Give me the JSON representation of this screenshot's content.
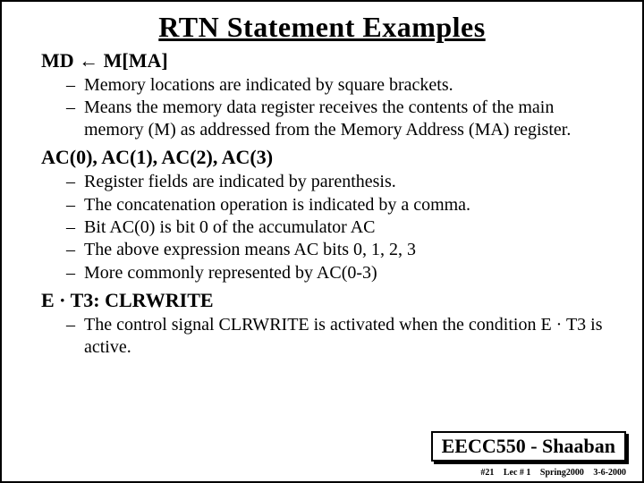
{
  "title": "RTN Statement Examples",
  "sections": [
    {
      "heading": "MD ←  M[MA]",
      "bullets": [
        "Memory locations are indicated by square brackets.",
        "Means the memory data register receives the contents of the main memory (M) as addressed from the Memory Address (MA) register."
      ]
    },
    {
      "heading": "AC(0), AC(1), AC(2), AC(3)",
      "bullets": [
        "Register fields are indicated by parenthesis.",
        "The concatenation operation is indicated by a  comma.",
        "Bit AC(0) is bit 0 of the accumulator AC",
        "The above expression means AC bits 0, 1, 2, 3",
        "More commonly represented by   AC(0-3)"
      ]
    },
    {
      "heading": "E · T3: CLRWRITE",
      "bullets": [
        "The control signal CLRWRITE is activated when the condition E · T3 is active."
      ]
    }
  ],
  "footer": {
    "course": "EECC550 - Shaaban",
    "slide_no": "#21",
    "lecture": "Lec # 1",
    "term": "Spring2000",
    "date": "3-6-2000"
  }
}
